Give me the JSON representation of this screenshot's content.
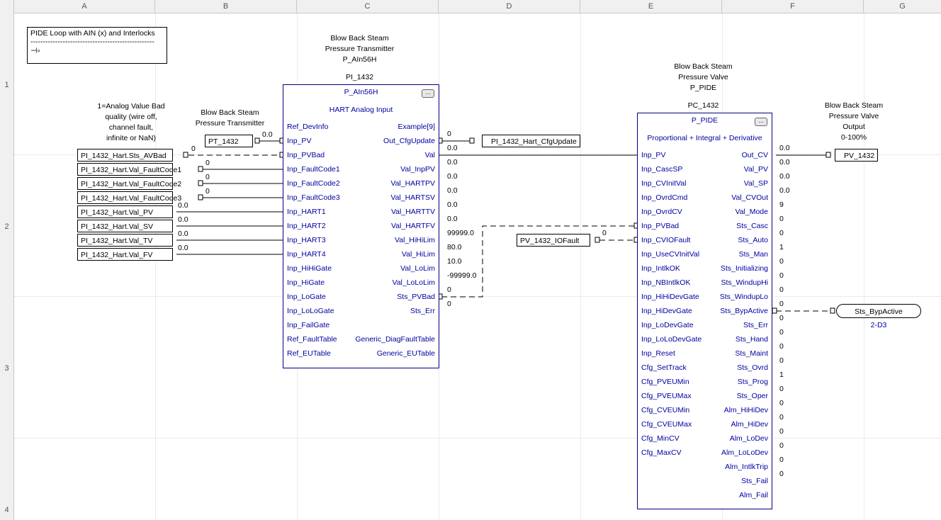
{
  "columns": [
    "A",
    "B",
    "C",
    "D",
    "E",
    "F",
    "G"
  ],
  "rows": [
    "1",
    "2",
    "3",
    "4"
  ],
  "note": {
    "title": "PIDE Loop with AIN (x) and Interlocks",
    "dashes": "--------------------------------------------------"
  },
  "input_refs": [
    {
      "tag": "PI_1432_Hart.Sts_AVBad",
      "value": "0"
    },
    {
      "tag": "PI_1432_Hart.Val_FaultCode1",
      "value": "0"
    },
    {
      "tag": "PI_1432_Hart.Val_FaultCode2",
      "value": "0"
    },
    {
      "tag": "PI_1432_Hart.Val_FaultCode3",
      "value": "0"
    },
    {
      "tag": "PI_1432_Hart.Val_PV",
      "value": "0.0"
    },
    {
      "tag": "PI_1432_Hart.Val_SV",
      "value": "0.0"
    },
    {
      "tag": "PI_1432_Hart.Val_TV",
      "value": "0.0"
    },
    {
      "tag": "PI_1432_Hart.Val_FV",
      "value": "0.0"
    }
  ],
  "quality_note": [
    "1=Analog Value Bad",
    "quality (wire off,",
    "channel fault,",
    "infinite or NaN)"
  ],
  "pt_label": [
    "Blow Back Steam",
    "Pressure Transmitter"
  ],
  "pt_tag": {
    "tag": "PT_1432",
    "value": "0.0"
  },
  "ain": {
    "header": [
      "Blow Back Steam",
      "Pressure Transmitter",
      "P_AIn56H"
    ],
    "name": "PI_1432",
    "type": "P_AIn56H",
    "desc": "HART Analog Input",
    "inputs": [
      "Ref_DevInfo",
      "Inp_PV",
      "Inp_PVBad",
      "Inp_FaultCode1",
      "Inp_FaultCode2",
      "Inp_FaultCode3",
      "Inp_HART1",
      "Inp_HART2",
      "Inp_HART3",
      "Inp_HART4",
      "Inp_HiHiGate",
      "Inp_HiGate",
      "Inp_LoGate",
      "Inp_LoLoGate",
      "Inp_FailGate",
      "Ref_FaultTable",
      "Ref_EUTable"
    ],
    "outputs": [
      "Example[9]",
      "Out_CfgUpdate",
      "Val",
      "Val_InpPV",
      "Val_HARTPV",
      "Val_HARTSV",
      "Val_HARTTV",
      "Val_HARTFV",
      "Val_HiHiLim",
      "Val_HiLim",
      "Val_LoLim",
      "Val_LoLoLim",
      "Sts_PVBad",
      "Sts_Err",
      "",
      "Generic_DiagFaultTable",
      "Generic_EUTable"
    ],
    "out_values": [
      "",
      "0",
      "0.0",
      "0.0",
      "0.0",
      "0.0",
      "0.0",
      "0.0",
      "99999.0",
      "80.0",
      "10.0",
      "-99999.0",
      "0",
      "0",
      "",
      "",
      ""
    ]
  },
  "cfg_update_tag": "PI_1432_Hart_CfgUpdate",
  "iofault_tag": {
    "tag": "PV_1432_IOFault",
    "value": "0"
  },
  "pide": {
    "header": [
      "Blow Back Steam",
      "Pressure Valve",
      "P_PIDE"
    ],
    "name": "PC_1432",
    "type": "P_PIDE",
    "desc": "Proportional + Integral + Derivative",
    "inputs": [
      "Inp_PV",
      "Inp_CascSP",
      "Inp_CVInitVal",
      "Inp_OvrdCmd",
      "Inp_OvrdCV",
      "Inp_PVBad",
      "Inp_CVIOFault",
      "Inp_UseCVInitVal",
      "Inp_IntlkOK",
      "Inp_NBIntlkOK",
      "Inp_HiHiDevGate",
      "Inp_HiDevGate",
      "Inp_LoDevGate",
      "Inp_LoLoDevGate",
      "Inp_Reset",
      "Cfg_SetTrack",
      "Cfg_PVEUMin",
      "Cfg_PVEUMax",
      "Cfg_CVEUMin",
      "Cfg_CVEUMax",
      "Cfg_MinCV",
      "Cfg_MaxCV"
    ],
    "outputs": [
      "Out_CV",
      "Val_PV",
      "Val_SP",
      "Val_CVOut",
      "Val_Mode",
      "Sts_Casc",
      "Sts_Auto",
      "Sts_Man",
      "Sts_Initializing",
      "Sts_WindupHi",
      "Sts_WindupLo",
      "Sts_BypActive",
      "Sts_Err",
      "Sts_Hand",
      "Sts_Maint",
      "Sts_Ovrd",
      "Sts_Prog",
      "Sts_Oper",
      "Alm_HiHiDev",
      "Alm_HiDev",
      "Alm_LoDev",
      "Alm_LoLoDev",
      "Alm_IntlkTrip",
      "Sts_Fail",
      "Alm_Fail"
    ],
    "out_values": [
      "0.0",
      "0.0",
      "0.0",
      "0.0",
      "9",
      "0",
      "0",
      "1",
      "0",
      "0",
      "0",
      "0",
      "0",
      "0",
      "0",
      "0",
      "1",
      "0",
      "0",
      "0",
      "0",
      "0",
      "0",
      "0",
      ""
    ]
  },
  "output_label": [
    "Blow Back Steam",
    "Pressure Valve",
    "Output",
    "0-100%"
  ],
  "pv_out_tag": "PV_1432",
  "byp_tag": "Sts_BypActive",
  "byp_ref": "2-D3"
}
